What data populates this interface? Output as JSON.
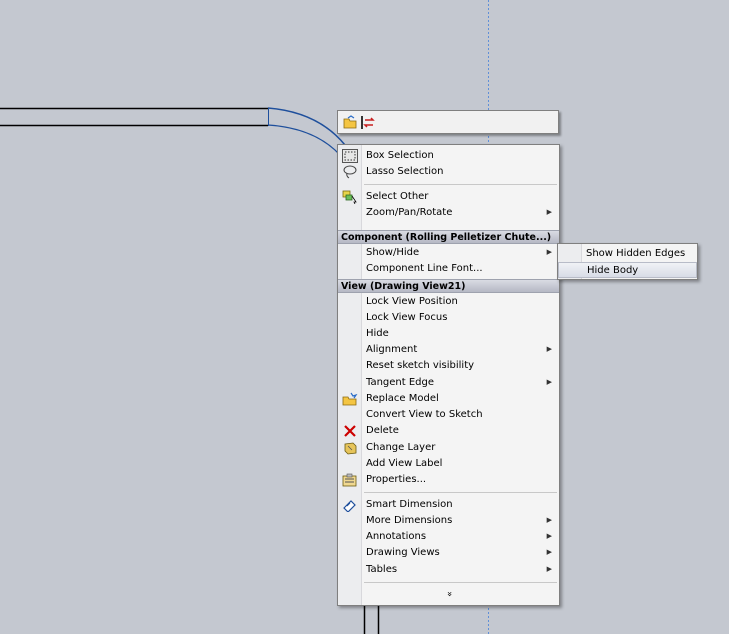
{
  "toolbar": {
    "buttons": [
      {
        "icon": "open-drawing-icon"
      },
      {
        "icon": "swap-icon"
      }
    ]
  },
  "menu": {
    "top_items": [
      {
        "label": "Box Selection",
        "icon": "box-selection-icon"
      },
      {
        "label": "Lasso Selection",
        "icon": "lasso-selection-icon"
      }
    ],
    "nav_items": [
      {
        "label": "Select Other",
        "icon": "select-other-icon"
      },
      {
        "label": "Zoom/Pan/Rotate",
        "submenu": true
      }
    ],
    "component_header": "Component (Rolling Pelletizer Chute...)",
    "component_items": [
      {
        "label": "Show/Hide",
        "submenu": true
      },
      {
        "label": "Component Line Font..."
      }
    ],
    "view_header": "View (Drawing View21)",
    "view_items": [
      {
        "label": "Lock View Position"
      },
      {
        "label": "Lock View Focus"
      },
      {
        "label": "Hide"
      },
      {
        "label": "Alignment",
        "submenu": true
      },
      {
        "label": "Reset sketch visibility"
      },
      {
        "label": "Tangent Edge",
        "submenu": true
      },
      {
        "label": "Replace Model",
        "icon": "replace-model-icon"
      },
      {
        "label": "Convert View to Sketch"
      },
      {
        "label": "Delete",
        "icon": "delete-icon"
      },
      {
        "label": "Change Layer",
        "icon": "change-layer-icon"
      },
      {
        "label": "Add View Label"
      },
      {
        "label": "Properties...",
        "icon": "properties-icon"
      }
    ],
    "dimension_items": [
      {
        "label": "Smart Dimension",
        "icon": "smart-dimension-icon"
      },
      {
        "label": "More Dimensions",
        "submenu": true
      },
      {
        "label": "Annotations",
        "submenu": true
      },
      {
        "label": "Drawing Views",
        "submenu": true
      },
      {
        "label": "Tables",
        "submenu": true
      }
    ],
    "more_glyph": "»"
  },
  "submenu": {
    "items": [
      {
        "label": "Show Hidden Edges"
      },
      {
        "label": "Hide Body",
        "highlighted": true
      }
    ]
  },
  "colors": {
    "canvas": "#c4c8d0",
    "model_edge": "#000000",
    "highlight_edge": "#1e4f9c",
    "guide": "#5f8fd8",
    "delete": "#cc0000"
  }
}
